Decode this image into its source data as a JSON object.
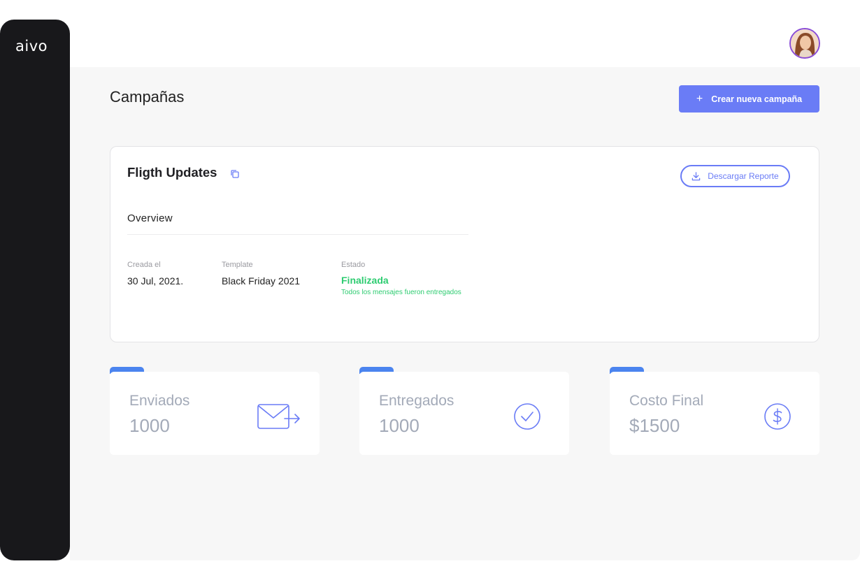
{
  "app": {
    "logo": "aivo"
  },
  "header": {
    "avatar_alt": "user-avatar"
  },
  "page": {
    "title": "Campañas",
    "create_button": {
      "icon": "+",
      "label": "Crear nueva campaña"
    }
  },
  "campaign": {
    "name": "Fligth Updates",
    "download_label": "Descargar Reporte",
    "overview_label": "Overview",
    "created": {
      "label": "Creada el",
      "value": "30 Jul, 2021."
    },
    "template": {
      "label": "Template",
      "value": "Black Friday 2021"
    },
    "status": {
      "label": "Estado",
      "value": "Finalizada",
      "note": "Todos los mensajes fueron entregados"
    }
  },
  "stats": [
    {
      "label": "Enviados",
      "value": "1000",
      "icon": "send-mail-icon"
    },
    {
      "label": "Entregados",
      "value": "1000",
      "icon": "check-circle-icon"
    },
    {
      "label": "Costo Final",
      "value": "$1500",
      "icon": "dollar-circle-icon"
    }
  ],
  "colors": {
    "accent": "#6a7cf6",
    "tab_blue": "#4b84ef",
    "success": "#2ecc71",
    "sidebar": "#18181b",
    "avatar_border": "#8a4dd6"
  }
}
